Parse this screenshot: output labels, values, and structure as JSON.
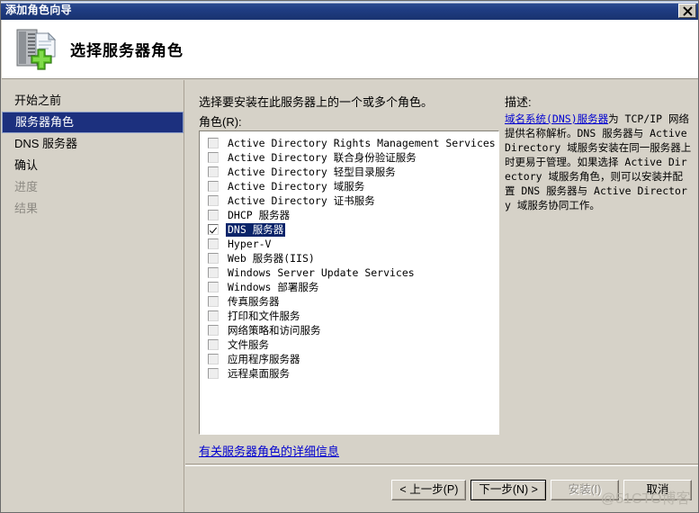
{
  "window": {
    "title": "添加角色向导",
    "close_label": "×"
  },
  "header": {
    "title": "选择服务器角色",
    "icon": "server-add-icon"
  },
  "sidebar": {
    "items": [
      {
        "label": "开始之前",
        "state": "normal"
      },
      {
        "label": "服务器角色",
        "state": "selected"
      },
      {
        "label": "DNS 服务器",
        "state": "normal"
      },
      {
        "label": "确认",
        "state": "normal"
      },
      {
        "label": "进度",
        "state": "disabled"
      },
      {
        "label": "结果",
        "state": "disabled"
      }
    ]
  },
  "main": {
    "intro": "选择要安装在此服务器上的一个或多个角色。",
    "roles_label": "角色(R):",
    "roles": [
      {
        "label": "Active Directory Rights Management Services",
        "checked": false,
        "selected": false
      },
      {
        "label": "Active Directory 联合身份验证服务",
        "checked": false,
        "selected": false
      },
      {
        "label": "Active Directory 轻型目录服务",
        "checked": false,
        "selected": false
      },
      {
        "label": "Active Directory 域服务",
        "checked": false,
        "selected": false
      },
      {
        "label": "Active Directory 证书服务",
        "checked": false,
        "selected": false
      },
      {
        "label": "DHCP 服务器",
        "checked": false,
        "selected": false
      },
      {
        "label": "DNS 服务器",
        "checked": true,
        "selected": true
      },
      {
        "label": "Hyper-V",
        "checked": false,
        "selected": false
      },
      {
        "label": "Web 服务器(IIS)",
        "checked": false,
        "selected": false
      },
      {
        "label": "Windows Server Update Services",
        "checked": false,
        "selected": false
      },
      {
        "label": "Windows 部署服务",
        "checked": false,
        "selected": false
      },
      {
        "label": "传真服务器",
        "checked": false,
        "selected": false
      },
      {
        "label": "打印和文件服务",
        "checked": false,
        "selected": false
      },
      {
        "label": "网络策略和访问服务",
        "checked": false,
        "selected": false
      },
      {
        "label": "文件服务",
        "checked": false,
        "selected": false
      },
      {
        "label": "应用程序服务器",
        "checked": false,
        "selected": false
      },
      {
        "label": "远程桌面服务",
        "checked": false,
        "selected": false
      }
    ],
    "more_info_link": "有关服务器角色的详细信息"
  },
  "description": {
    "title": "描述:",
    "link_text": "域名系统(DNS)服务器",
    "body": "为 TCP/IP 网络提供名称解析。DNS 服务器与 Active Directory 域服务安装在同一服务器上时更易于管理。如果选择 Active Directory 域服务角色，则可以安装并配置 DNS 服务器与 Active Directory 域服务协同工作。"
  },
  "buttons": {
    "back": "< 上一步(P)",
    "next": "下一步(N) >",
    "install": "安装(I)",
    "cancel": "取消"
  },
  "watermark": "@51CTO博客",
  "colors": {
    "titlebar": "#1f3c82",
    "selection": "#0a246a",
    "face": "#d6d2c8",
    "link": "#0000d0"
  }
}
